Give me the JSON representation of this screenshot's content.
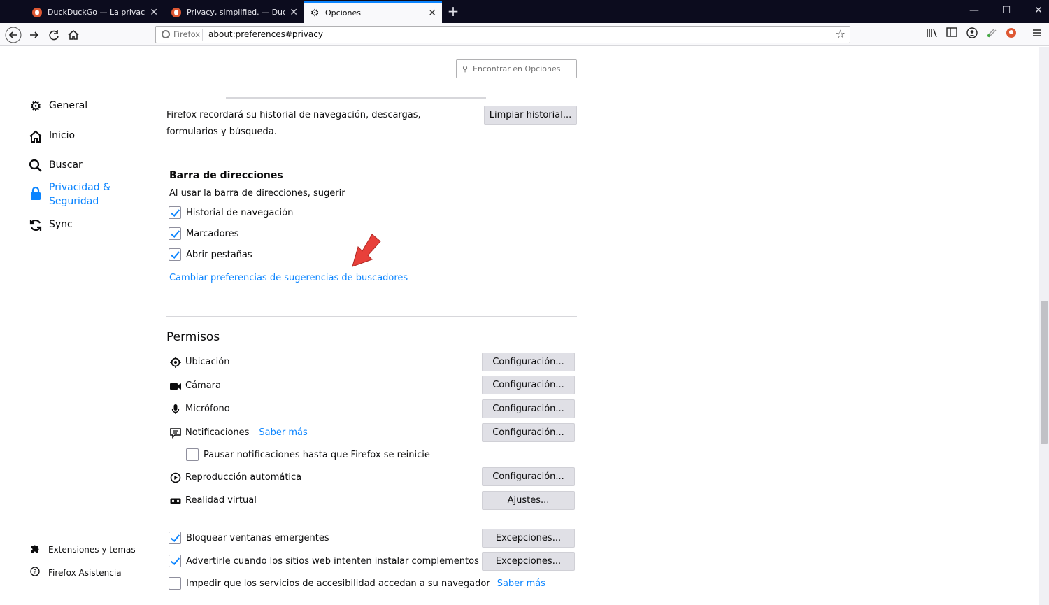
{
  "tabs": [
    {
      "title": "DuckDuckGo — La privacidad,",
      "icon": "duckduckgo-icon"
    },
    {
      "title": "Privacy, simplified. — DuckDu",
      "icon": "duckduckgo-icon"
    },
    {
      "title": "Opciones",
      "icon": "gear-icon"
    }
  ],
  "urlbar": {
    "identity": "Firefox",
    "url": "about:preferences#privacy"
  },
  "search": {
    "placeholder": "Encontrar en Opciones"
  },
  "sidebar": {
    "items": [
      {
        "label": "General",
        "icon": "gear-icon"
      },
      {
        "label": "Inicio",
        "icon": "home-icon"
      },
      {
        "label": "Buscar",
        "icon": "search-icon"
      },
      {
        "label": "Privacidad & Seguridad",
        "icon": "lock-icon",
        "selected": true
      },
      {
        "label": "Sync",
        "icon": "sync-icon"
      }
    ],
    "footer": [
      {
        "label": "Extensiones y temas",
        "icon": "puzzle-icon"
      },
      {
        "label": "Firefox Asistencia",
        "icon": "help-icon"
      }
    ]
  },
  "history": {
    "text": "Firefox recordará su historial de navegación, descargas, formularios y búsqueda.",
    "clear_button": "Limpiar historial..."
  },
  "address_bar": {
    "heading": "Barra de direcciones",
    "subtitle": "Al usar la barra de direcciones, sugerir",
    "options": [
      {
        "label": "Historial de navegación",
        "checked": true
      },
      {
        "label": "Marcadores",
        "checked": true
      },
      {
        "label": "Abrir pestañas",
        "checked": true
      }
    ],
    "link": "Cambiar preferencias de sugerencias de buscadores"
  },
  "permissions": {
    "heading": "Permisos",
    "items": [
      {
        "label": "Ubicación",
        "icon": "location-icon",
        "button": "Configuración..."
      },
      {
        "label": "Cámara",
        "icon": "camera-icon",
        "button": "Configuración..."
      },
      {
        "label": "Micrófono",
        "icon": "microphone-icon",
        "button": "Configuración..."
      },
      {
        "label": "Notificaciones",
        "icon": "notification-icon",
        "button": "Configuración...",
        "link": "Saber más"
      },
      {
        "label": "Reproducción automática",
        "icon": "autoplay-icon",
        "button": "Configuración..."
      },
      {
        "label": "Realidad virtual",
        "icon": "vr-icon",
        "button": "Ajustes..."
      }
    ],
    "pause_notifications": {
      "label": "Pausar notificaciones hasta que Firefox se reinicie",
      "checked": false
    },
    "extra": [
      {
        "label": "Bloquear ventanas emergentes",
        "checked": true,
        "button": "Excepciones..."
      },
      {
        "label": "Advertirle cuando los sitios web intenten instalar complementos",
        "checked": true,
        "button": "Excepciones..."
      },
      {
        "label": "Impedir que los servicios de accesibilidad accedan a su navegador",
        "checked": false,
        "link": "Saber más"
      }
    ]
  },
  "colors": {
    "accent": "#0a84ff",
    "tabstrip": "#0c0c1e",
    "arrow": "#e8403a"
  }
}
